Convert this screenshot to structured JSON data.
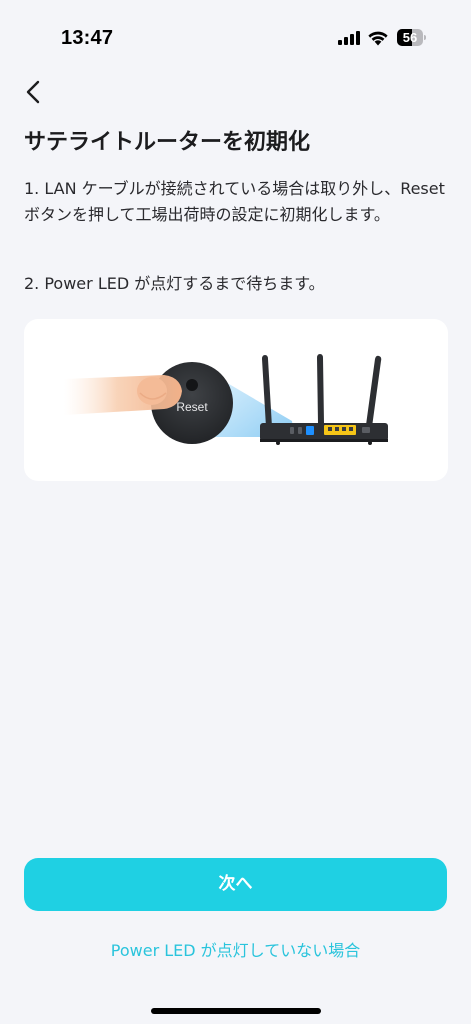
{
  "status_bar": {
    "time": "13:47",
    "battery_level": "56",
    "battery_fraction": 0.56
  },
  "header": {
    "back_icon": "chevron-left-icon",
    "title": "サテライトルーターを初期化"
  },
  "instructions": {
    "step1": "1. LAN ケーブルが接続されている場合は取り外し、Reset ボタンを押して工場出荷時の設定に初期化します。",
    "step2": "2. Power LED が点灯するまで待ちます。"
  },
  "illustration": {
    "reset_label": "Reset",
    "colors": {
      "lan_ports": "#f5c518",
      "wan_port": "#1e90ff",
      "router_body": "#2d2f33",
      "highlight_beam": "#7fc6f2"
    }
  },
  "footer": {
    "next_label": "次へ",
    "help_link": "Power LED が点灯していない場合"
  },
  "colors": {
    "accent": "#1fd0e3",
    "link": "#2ac4dc",
    "background": "#f4f5f9"
  }
}
